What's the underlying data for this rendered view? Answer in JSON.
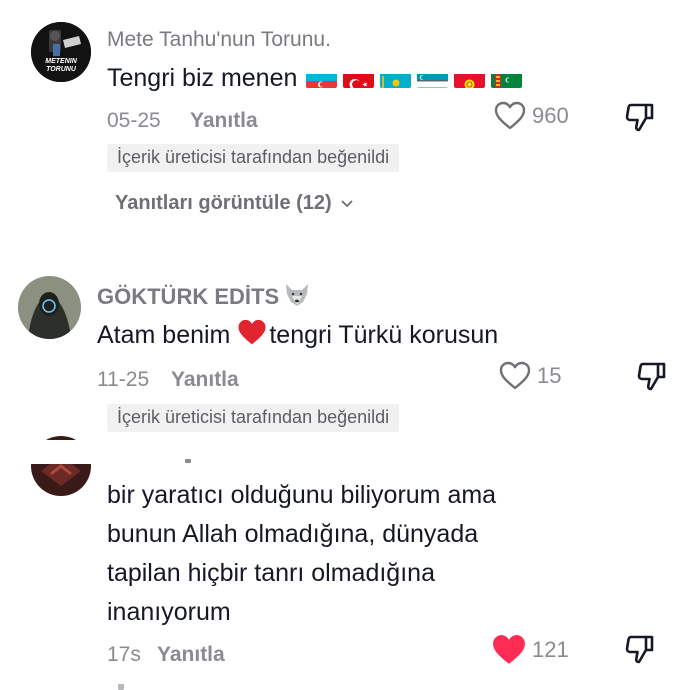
{
  "comments": [
    {
      "username": "Mete Tanhu'nun Torunu.",
      "avatar_text": "METENIN TORUNU",
      "text": "Tengri biz menen",
      "flags": [
        "azerbaijan-flag",
        "turkey-flag",
        "kazakhstan-flag",
        "uzbekistan-flag",
        "kyrgyzstan-flag",
        "turkmenistan-flag"
      ],
      "date": "05-25",
      "reply_label": "Yanıtla",
      "likes": "960",
      "liked": false,
      "creator_liked_badge": "İçerik üreticisi tarafından beğenildi",
      "view_replies": "Yanıtları görüntüle (12)"
    },
    {
      "username": "GÖKTÜRK EDİTS",
      "username_emoji": "wolf-emoji",
      "text_before": "Atam benim ",
      "text_after": "tengri Türkü korusun",
      "date": "11-25",
      "reply_label": "Yanıtla",
      "likes": "15",
      "liked": false,
      "creator_liked_badge": "İçerik üreticisi tarafından beğenildi"
    },
    {
      "lines": [
        "bir yaratıcı olduğunu biliyorum ama",
        "bunun Allah olmadığına, dünyada",
        "tapilan hiçbir tanrı olmadığına",
        "inanıyorum"
      ],
      "date": "17s",
      "reply_label": "Yanıtla",
      "likes": "121",
      "liked": true
    }
  ],
  "colors": {
    "text": "#161823",
    "secondary": "#8a8b91",
    "like_active": "#fe2c55",
    "badge_bg": "#f1f1f2"
  }
}
